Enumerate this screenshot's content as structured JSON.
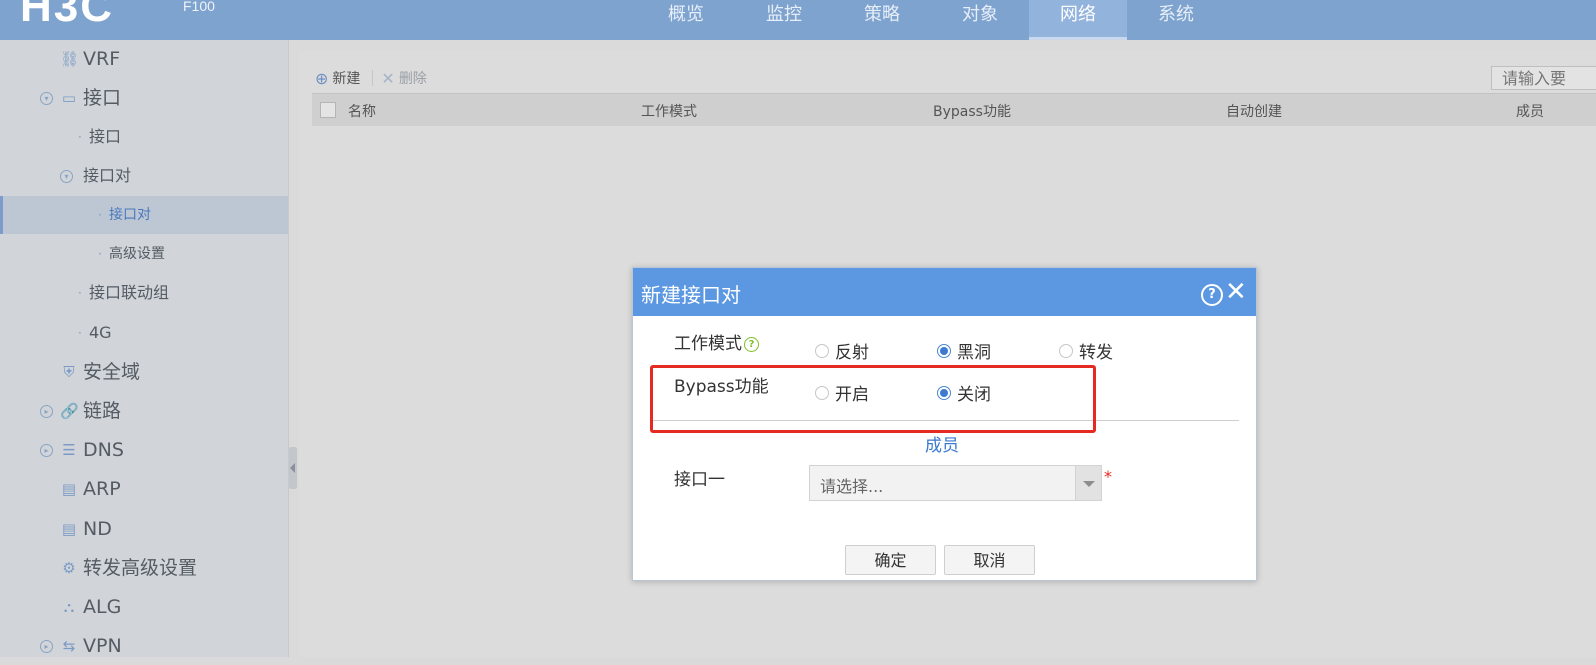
{
  "header": {
    "logo_text": "H3C",
    "model": "F100",
    "nav": [
      "概览",
      "监控",
      "策略",
      "对象",
      "网络",
      "系统"
    ],
    "active_nav": "网络"
  },
  "sidebar": {
    "items": [
      {
        "label": "VRF",
        "icon": "vrf-icon"
      },
      {
        "label": "接口",
        "icon": "interface-icon",
        "expand": "collapse-icon"
      },
      {
        "label": "接口"
      },
      {
        "label": "接口对",
        "expand": "collapse-icon"
      },
      {
        "label": "接口对",
        "selected": true
      },
      {
        "label": "高级设置"
      },
      {
        "label": "接口联动组"
      },
      {
        "label": "4G"
      },
      {
        "label": "安全域",
        "icon": "shield-icon"
      },
      {
        "label": "链路",
        "icon": "link-icon",
        "expand": "expand-icon"
      },
      {
        "label": "DNS",
        "icon": "database-icon",
        "expand": "expand-icon"
      },
      {
        "label": "ARP",
        "icon": "arp-icon"
      },
      {
        "label": "ND",
        "icon": "nd-icon"
      },
      {
        "label": "转发高级设置",
        "icon": "forward-settings-icon"
      },
      {
        "label": "ALG",
        "icon": "alg-icon"
      },
      {
        "label": "VPN",
        "icon": "vpn-icon",
        "expand": "expand-icon"
      }
    ]
  },
  "toolbar": {
    "new_label": "新建",
    "delete_label": "删除",
    "search_placeholder": "请输入要"
  },
  "table": {
    "columns": [
      "名称",
      "工作模式",
      "Bypass功能",
      "自动创建",
      "成员"
    ]
  },
  "dialog": {
    "title": "新建接口对",
    "work_mode_label": "工作模式",
    "work_mode_options": [
      "反射",
      "黑洞",
      "转发"
    ],
    "work_mode_selected": "黑洞",
    "bypass_label": "Bypass功能",
    "bypass_options": [
      "开启",
      "关闭"
    ],
    "bypass_selected": "关闭",
    "section_title": "成员",
    "interface1_label": "接口一",
    "interface1_placeholder": "请选择...",
    "required_mark": "*",
    "ok_label": "确定",
    "cancel_label": "取消"
  },
  "colors": {
    "topbar": "#7fa3cf",
    "dialog_header": "#5b98e1",
    "highlight": "#e52a22",
    "link_blue": "#3b79cf"
  }
}
